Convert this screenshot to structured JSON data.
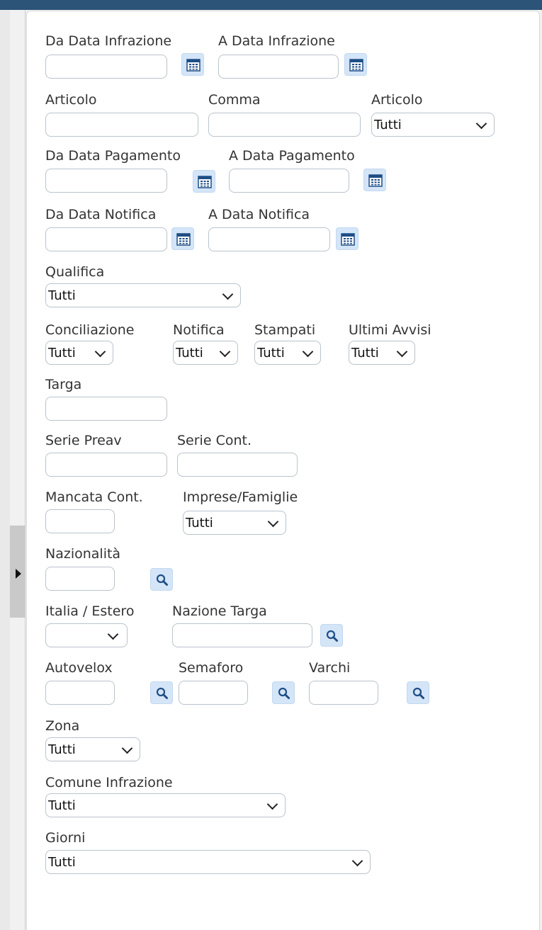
{
  "colors": {
    "header_bar": "#2c5378",
    "icon_button_bg": "#d4e5f8",
    "icon_color": "#1f4e86",
    "border": "#b9c3cc"
  },
  "icons": {
    "date_picker": "calendar-icon",
    "lookup": "search-icon",
    "collapse": "triangle-right-icon",
    "dropdown": "chevron-down-icon"
  },
  "fields": {
    "da_data_infrazione": {
      "label": "Da Data Infrazione",
      "value": ""
    },
    "a_data_infrazione": {
      "label": "A Data Infrazione",
      "value": ""
    },
    "articolo": {
      "label": "Articolo",
      "value": ""
    },
    "comma": {
      "label": "Comma",
      "value": ""
    },
    "articolo_select": {
      "label": "Articolo",
      "value": "Tutti"
    },
    "da_data_pagamento": {
      "label": "Da Data Pagamento",
      "value": ""
    },
    "a_data_pagamento": {
      "label": "A Data Pagamento",
      "value": ""
    },
    "da_data_notifica": {
      "label": "Da Data Notifica",
      "value": ""
    },
    "a_data_notifica": {
      "label": "A Data Notifica",
      "value": ""
    },
    "qualifica": {
      "label": "Qualifica",
      "value": "Tutti"
    },
    "conciliazione": {
      "label": "Conciliazione",
      "value": "Tutti"
    },
    "notifica": {
      "label": "Notifica",
      "value": "Tutti"
    },
    "stampati": {
      "label": "Stampati",
      "value": "Tutti"
    },
    "ultimi_avvisi": {
      "label": "Ultimi Avvisi",
      "value": "Tutti"
    },
    "targa": {
      "label": "Targa",
      "value": ""
    },
    "serie_preav": {
      "label": "Serie Preav",
      "value": ""
    },
    "serie_cont": {
      "label": "Serie Cont.",
      "value": ""
    },
    "mancata_cont": {
      "label": "Mancata Cont.",
      "value": ""
    },
    "imprese_famiglie": {
      "label": "Imprese/Famiglie",
      "value": "Tutti"
    },
    "nazionalita": {
      "label": "Nazionalità",
      "value": ""
    },
    "italia_estero": {
      "label": "Italia / Estero",
      "value": ""
    },
    "nazione_targa": {
      "label": "Nazione Targa",
      "value": ""
    },
    "autovelox": {
      "label": "Autovelox",
      "value": ""
    },
    "semaforo": {
      "label": "Semaforo",
      "value": ""
    },
    "varchi": {
      "label": "Varchi",
      "value": ""
    },
    "zona": {
      "label": "Zona",
      "value": "Tutti"
    },
    "comune_infrazione": {
      "label": "Comune Infrazione",
      "value": "Tutti"
    },
    "giorni": {
      "label": "Giorni",
      "value": "Tutti"
    }
  }
}
